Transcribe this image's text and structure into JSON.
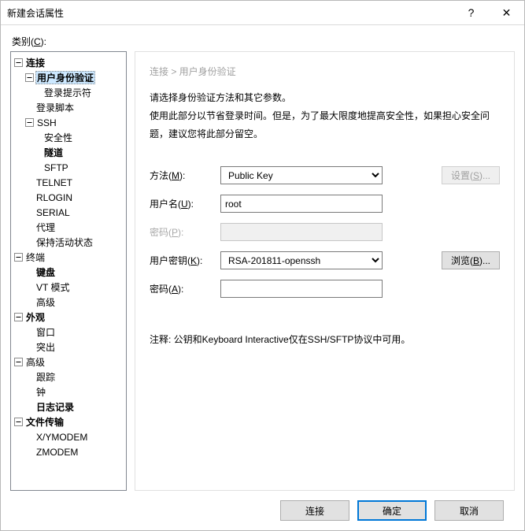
{
  "window": {
    "title": "新建会话属性",
    "help": "?",
    "close": "✕"
  },
  "category_label_pre": "类别(",
  "category_label_u": "C",
  "category_label_post": "):",
  "tree": {
    "connection": "连接",
    "auth": "用户身份验证",
    "login_prompt": "登录提示符",
    "login_script": "登录脚本",
    "ssh": "SSH",
    "security": "安全性",
    "tunnel": "隧道",
    "sftp": "SFTP",
    "telnet": "TELNET",
    "rlogin": "RLOGIN",
    "serial": "SERIAL",
    "proxy": "代理",
    "keepalive": "保持活动状态",
    "terminal": "终端",
    "keyboard": "键盘",
    "vtmode": "VT 模式",
    "advanced": "高级",
    "appearance": "外观",
    "windowopt": "窗口",
    "highlight": "突出",
    "adv": "高级",
    "trace": "跟踪",
    "clock": "钟",
    "log": "日志记录",
    "filetransfer": "文件传输",
    "xymodem": "X/YMODEM",
    "zmodem": "ZMODEM"
  },
  "breadcrumb": "连接  >  用户身份验证",
  "desc1": "请选择身份验证方法和其它参数。",
  "desc2": "使用此部分以节省登录时间。但是，为了最大限度地提高安全性，如果担心安全问题，建议您将此部分留空。",
  "labels": {
    "method_pre": "方法(",
    "method_u": "M",
    "method_post": "):",
    "user_pre": "用户名(",
    "user_u": "U",
    "user_post": "):",
    "pass_pre": "密码(",
    "pass_u": "P",
    "pass_post": "):",
    "key_pre": "用户密钥(",
    "key_u": "K",
    "key_post": "):",
    "pass2_pre": "密码(",
    "pass2_u": "A",
    "pass2_post": "):"
  },
  "values": {
    "method": "Public Key",
    "username": "root",
    "password": "",
    "userkey": "RSA-201811-openssh",
    "keypass": ""
  },
  "buttons": {
    "setup_pre": "设置(",
    "setup_u": "S",
    "setup_post": ")...",
    "browse_pre": "浏览(",
    "browse_u": "B",
    "browse_post": ")...",
    "connect": "连接",
    "ok": "确定",
    "cancel": "取消"
  },
  "note": "注释: 公钥和Keyboard Interactive仅在SSH/SFTP协议中可用。"
}
